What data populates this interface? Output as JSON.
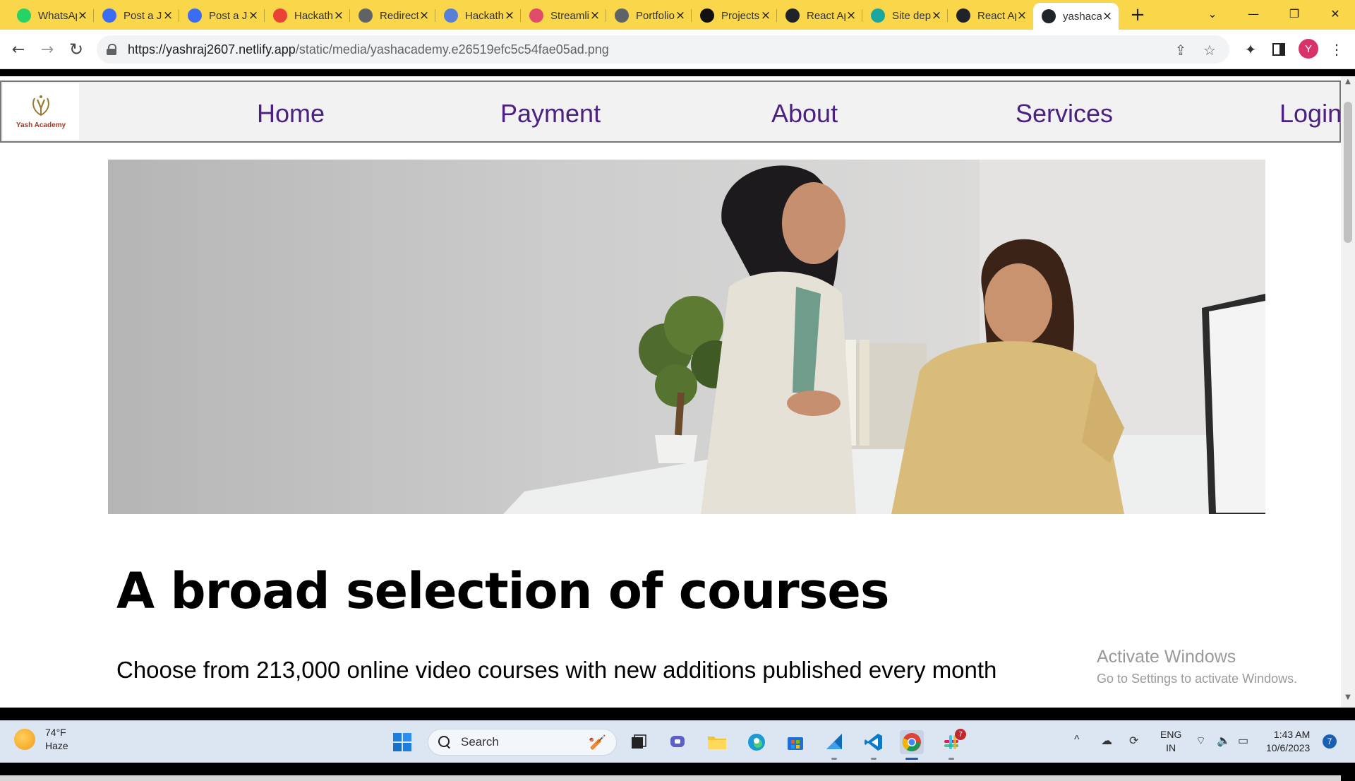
{
  "browser": {
    "tabs": [
      {
        "title": "WhatsApp",
        "icon": "whatsapp-icon",
        "color": "#25d366"
      },
      {
        "title": "Post a Job",
        "icon": "z-icon",
        "color": "#3b6cf6"
      },
      {
        "title": "Post a Job",
        "icon": "z-icon",
        "color": "#3b6cf6"
      },
      {
        "title": "Hackathon",
        "icon": "gmail-icon",
        "color": "#ea4335"
      },
      {
        "title": "Redirect",
        "icon": "globe-icon",
        "color": "#5f6368"
      },
      {
        "title": "Hackathon",
        "icon": "robot-icon",
        "color": "#5a7fd8"
      },
      {
        "title": "Streamlit",
        "icon": "stream-icon",
        "color": "#e04a6b"
      },
      {
        "title": "Portfolio",
        "icon": "globe-icon",
        "color": "#5f6368"
      },
      {
        "title": "Projects",
        "icon": "github-icon",
        "color": "#111111"
      },
      {
        "title": "React App",
        "icon": "react-icon",
        "color": "#20232a"
      },
      {
        "title": "Site deploy",
        "icon": "netlify-icon",
        "color": "#19a7a0"
      },
      {
        "title": "React App",
        "icon": "react-icon",
        "color": "#20232a"
      },
      {
        "title": "yashacademy",
        "icon": "react-icon",
        "color": "#20232a",
        "active": true
      }
    ],
    "url_host": "https://yashraj2607.netlify.app",
    "url_path": "/static/media/yashacademy.e26519efc5c54fae05ad.png",
    "profile_initial": "Y"
  },
  "site": {
    "logo_text": "Yash Academy",
    "nav": [
      "Home",
      "Payment",
      "About",
      "Services",
      "Login"
    ],
    "heading": "A broad selection of courses",
    "subheading": "Choose from 213,000 online video courses with new additions published every month"
  },
  "watermark": {
    "line1": "Activate Windows",
    "line2": "Go to Settings to activate Windows."
  },
  "taskbar": {
    "temperature": "74°F",
    "weather": "Haze",
    "search_label": "Search",
    "language": "ENG",
    "region": "IN",
    "time": "1:43 AM",
    "date": "10/6/2023",
    "notification_count": "7",
    "slack_badge": "7"
  }
}
